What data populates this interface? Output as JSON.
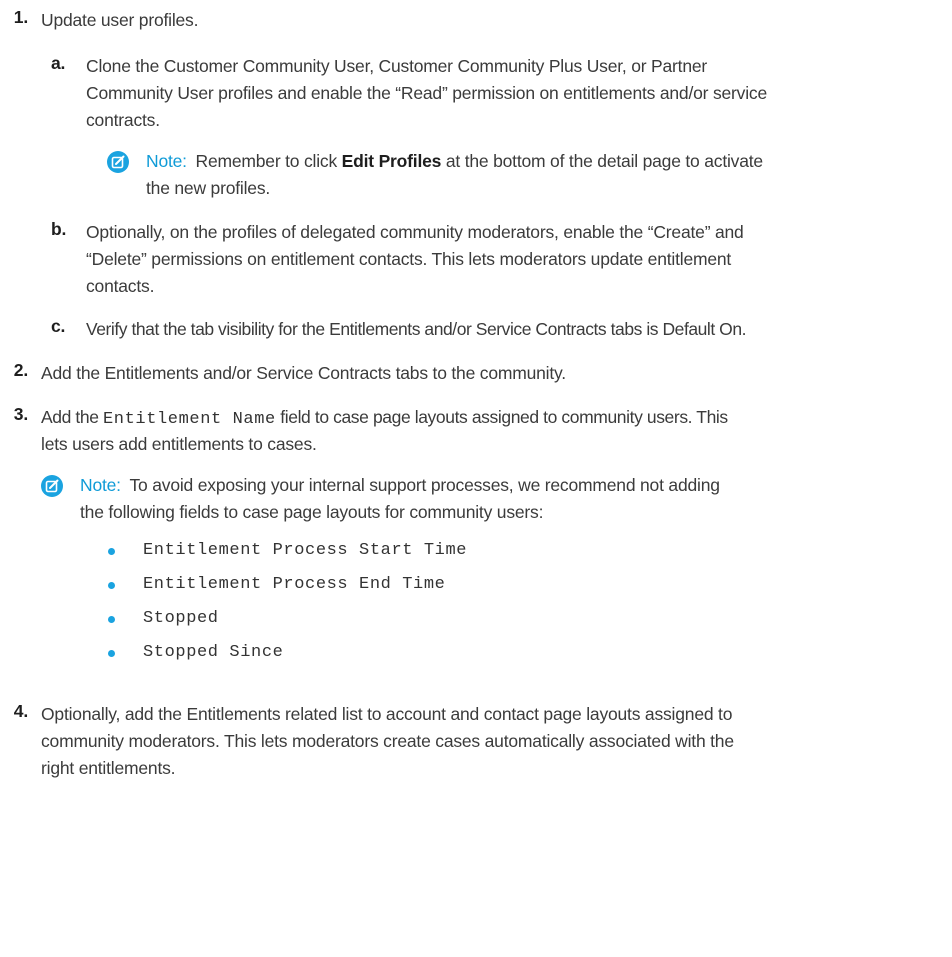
{
  "colors": {
    "text": "#3b3b3b",
    "accent": "#1aa3e0",
    "note_label": "#0f9bd7"
  },
  "steps": [
    {
      "number": "1.",
      "text": "Update user profiles.",
      "substeps": [
        {
          "letter": "a.",
          "lines": [
            "Clone the Customer Community User, Customer Community Plus User, or Partner",
            "Community User profiles and enable the “Read” permission on entitlements and/or service",
            "contracts."
          ],
          "note": {
            "label": "Note:",
            "line1_before": "Remember to click ",
            "line1_bold": "Edit Profiles",
            "line1_after": " at the bottom of the detail page to activate",
            "line2": "the new profiles.",
            "icon": "edit-note-icon"
          }
        },
        {
          "letter": "b.",
          "lines": [
            "Optionally, on the profiles of delegated community moderators, enable the “Create” and",
            "“Delete” permissions on entitlement contacts. This lets moderators update entitlement",
            "contacts."
          ]
        },
        {
          "letter": "c.",
          "lines": [
            "Verify that the tab visibility for the Entitlements and/or Service Contracts tabs is Default On."
          ]
        }
      ]
    },
    {
      "number": "2.",
      "text": "Add the Entitlements and/or Service Contracts tabs to the community."
    },
    {
      "number": "3.",
      "line1_before": "Add the ",
      "line1_code": "Entitlement Name",
      "line1_after": " field to case page layouts assigned to community users. This",
      "line2": "lets users add entitlements to cases.",
      "note": {
        "label": "Note:",
        "line1": "To avoid exposing your internal support processes, we recommend not adding",
        "line2": "the following fields to case page layouts for community users:",
        "icon": "edit-note-icon",
        "fields": [
          "Entitlement Process Start Time",
          "Entitlement Process End Time",
          "Stopped",
          "Stopped Since"
        ]
      }
    },
    {
      "number": "4.",
      "lines": [
        "Optionally, add the Entitlements related list to account and contact page layouts assigned to",
        "community moderators. This lets moderators create cases automatically associated with the",
        "right entitlements."
      ]
    }
  ]
}
